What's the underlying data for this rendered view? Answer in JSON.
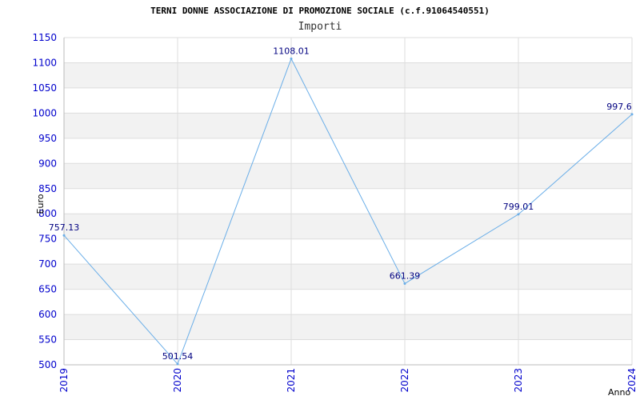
{
  "chart_data": {
    "type": "line",
    "title": "TERNI DONNE ASSOCIAZIONE DI PROMOZIONE SOCIALE (c.f.91064540551)",
    "subtitle": "Importi",
    "xlabel": "Anno",
    "ylabel": "Euro",
    "x": [
      "2019",
      "2020",
      "2021",
      "2022",
      "2023",
      "2024"
    ],
    "series": [
      {
        "values": [
          757.13,
          501.54,
          1108.01,
          661.39,
          799.01,
          997.6
        ],
        "labels": [
          "757.13",
          "501.54",
          "1108.01",
          "661.39",
          "799.01",
          "997.6"
        ]
      }
    ],
    "ylim": [
      500,
      1150
    ],
    "yticks": [
      500,
      550,
      600,
      650,
      700,
      750,
      800,
      850,
      900,
      950,
      1000,
      1050,
      1100,
      1150
    ],
    "grid": true,
    "colors": {
      "line": "#6aaee8",
      "tick_label": "#0000cc",
      "data_label": "#000080",
      "band": "#f2f2f2",
      "gridline": "#dddddd"
    }
  }
}
